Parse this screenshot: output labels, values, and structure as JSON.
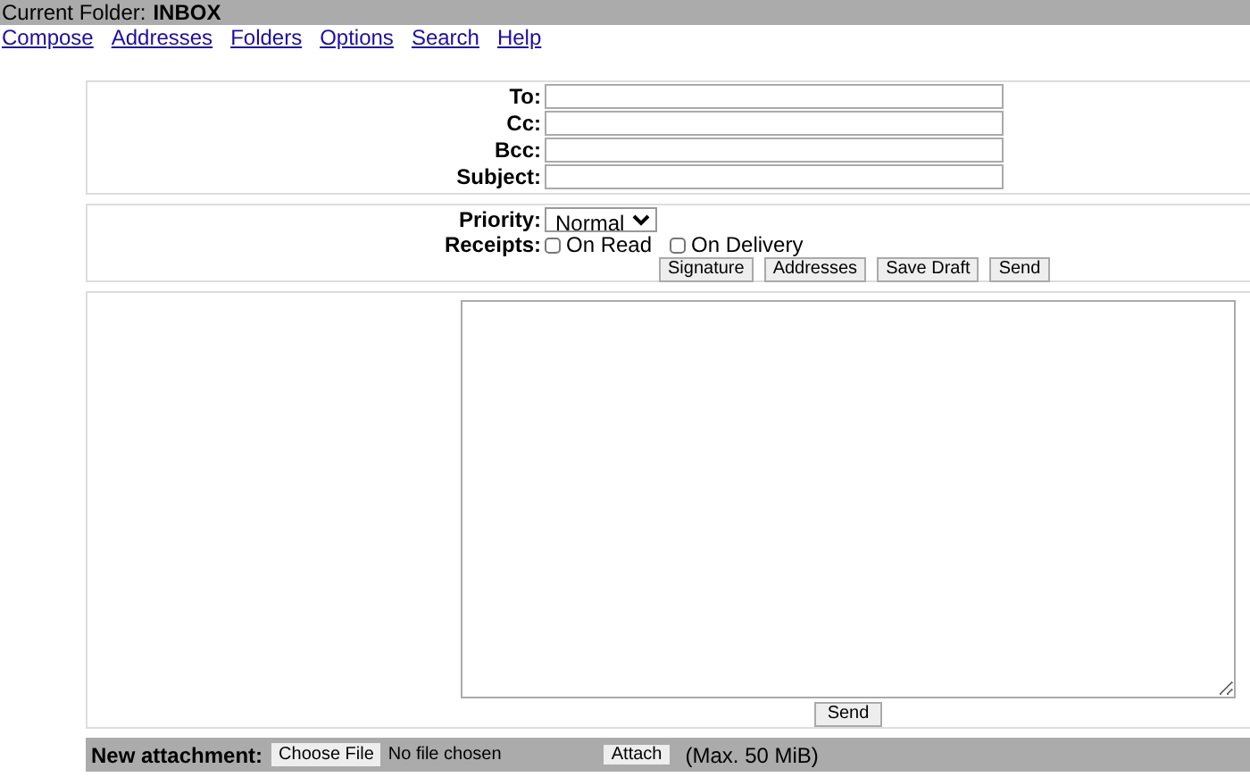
{
  "folder_bar": {
    "label": "Current Folder:",
    "folder": "INBOX"
  },
  "menu": [
    "Compose",
    "Addresses",
    "Folders",
    "Options",
    "Search",
    "Help"
  ],
  "header_fields": [
    {
      "label": "To:"
    },
    {
      "label": "Cc:"
    },
    {
      "label": "Bcc:"
    },
    {
      "label": "Subject:"
    }
  ],
  "priority": {
    "label": "Priority:",
    "value": "Normal"
  },
  "receipts": {
    "label": "Receipts:",
    "options": [
      {
        "label": "On Read",
        "checked": false
      },
      {
        "label": "On Delivery",
        "checked": false
      }
    ]
  },
  "action_buttons": [
    "Signature",
    "Addresses",
    "Save Draft",
    "Send"
  ],
  "body_send_button": "Send",
  "attachment": {
    "label": "New attachment:",
    "choose_button": "Choose File",
    "file_status": "No file chosen",
    "attach_button": "Attach",
    "limit": "(Max. 50 MiB)"
  }
}
